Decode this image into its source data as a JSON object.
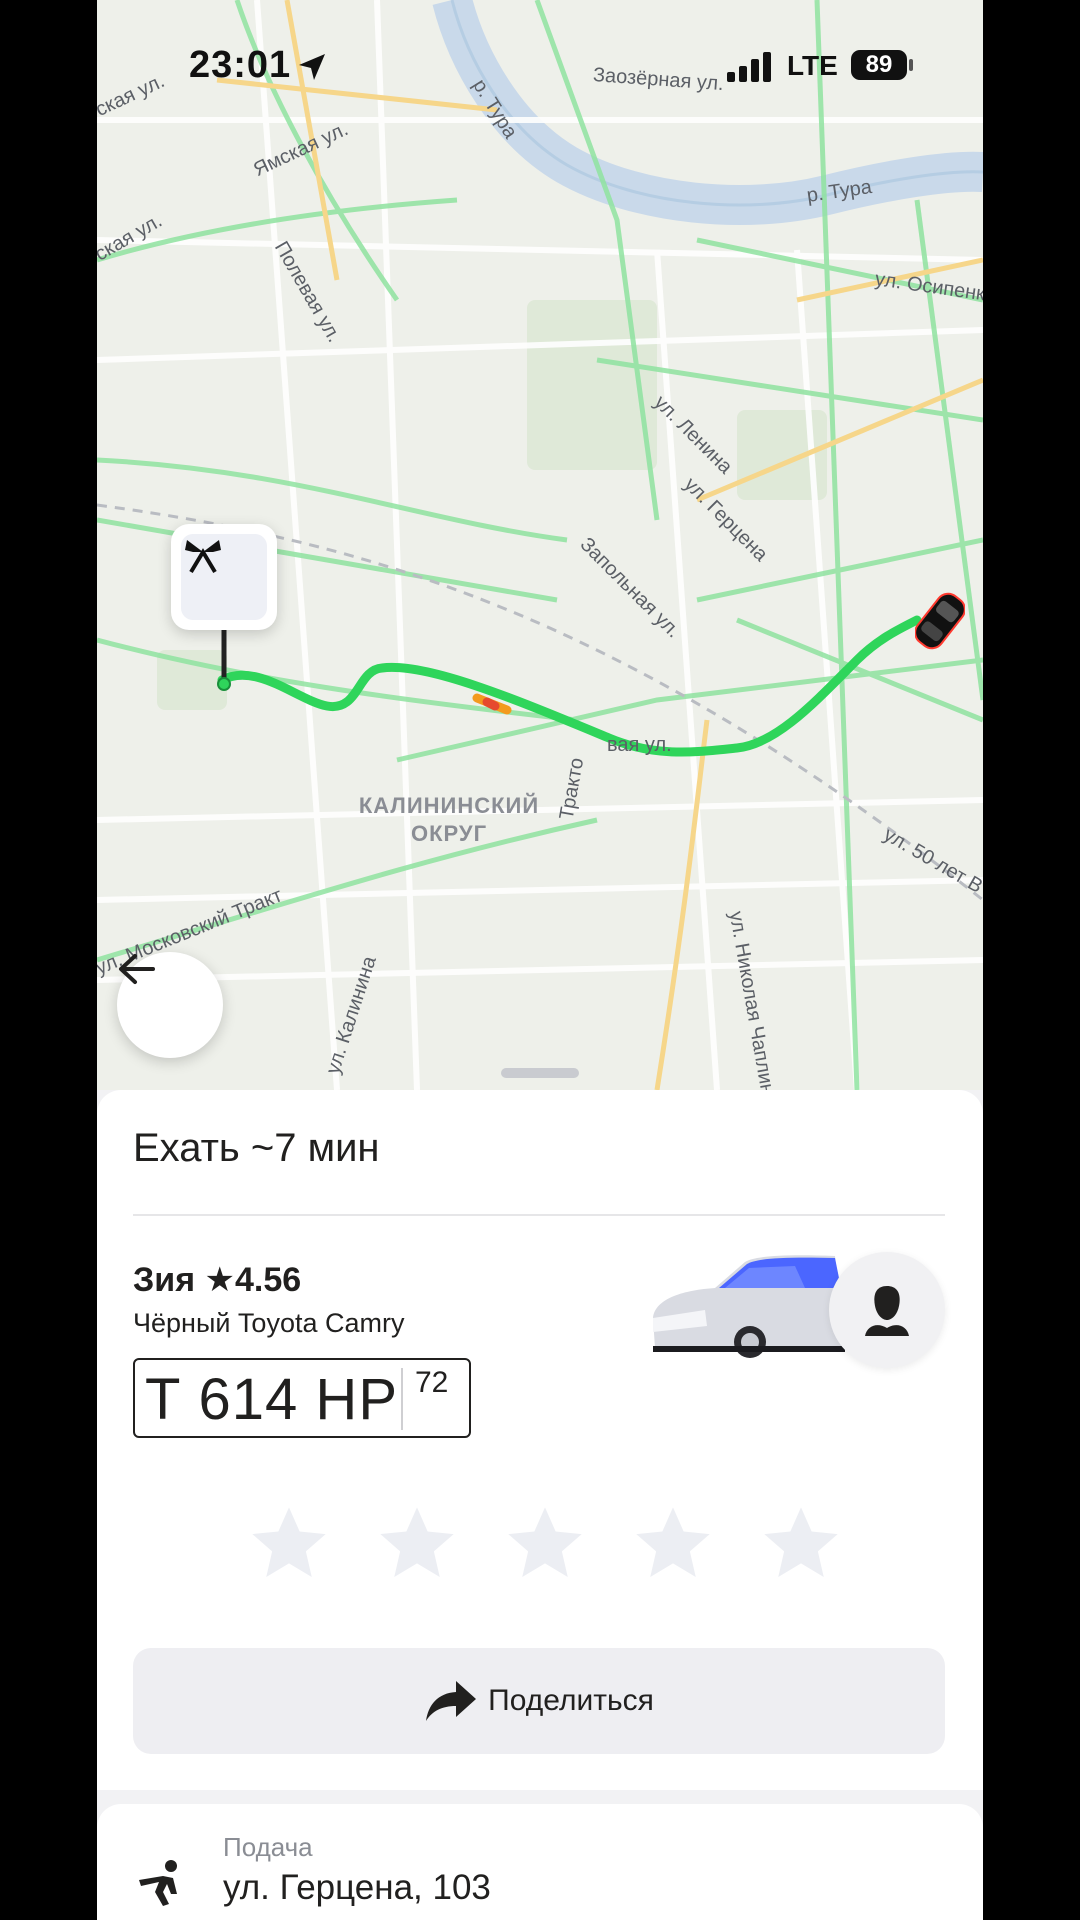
{
  "status_bar": {
    "time": "23:01",
    "network": "LTE",
    "battery": "89"
  },
  "map": {
    "labels": {
      "tura1": "р. Тура",
      "tura2": "р. Тура",
      "yamskaya": "Ямская ул.",
      "yamskaya2": "ская ул.",
      "yamskaya3": "ская ул.",
      "polevaya": "Полевая ул.",
      "zaozernaya": "Заозёрная ул.",
      "osipenko": "ул. Осипенко",
      "lenina": "ул. Ленина",
      "gertsena": "ул. Герцена",
      "zapolnaya": "Запольная ул.",
      "traktovaya1": "Тракто",
      "traktovaya2": "вая ул.",
      "moskovsky": "ул. Московский Тракт",
      "kalinina": "ул. Калинина",
      "chaplina": "ул. Николая Чаплина",
      "fifty_years": "ул. 50 лет В",
      "zaozernaya_top": "Заозерная ул."
    },
    "district_line1": "КАЛИНИНСКИЙ",
    "district_line2": "ОКРУГ",
    "route_color": "#2fd55b",
    "traffic_color": "#f39a1e"
  },
  "trip": {
    "eta": "Ехать ~7 мин",
    "driver": "Зия ★4.56",
    "car_description": "Чёрный Toyota Camry",
    "plate_number": "Т 614 НР",
    "plate_region": "72",
    "rating_max": 5,
    "rating_value": 0,
    "share_label": "Поделиться"
  },
  "pickup": {
    "caption": "Подача",
    "address": "ул. Герцена, 103"
  },
  "colors": {
    "accent_route": "#2fd55b",
    "text_primary": "#21201f",
    "button_bg": "#eeeef2"
  },
  "icons": [
    "location-arrow-icon",
    "signal-icon",
    "battery-icon",
    "back-arrow-icon",
    "pickup-flags-icon",
    "car-marker-icon",
    "driver-avatar-icon",
    "star-icon",
    "share-arrow-icon",
    "pickup-walk-icon"
  ]
}
